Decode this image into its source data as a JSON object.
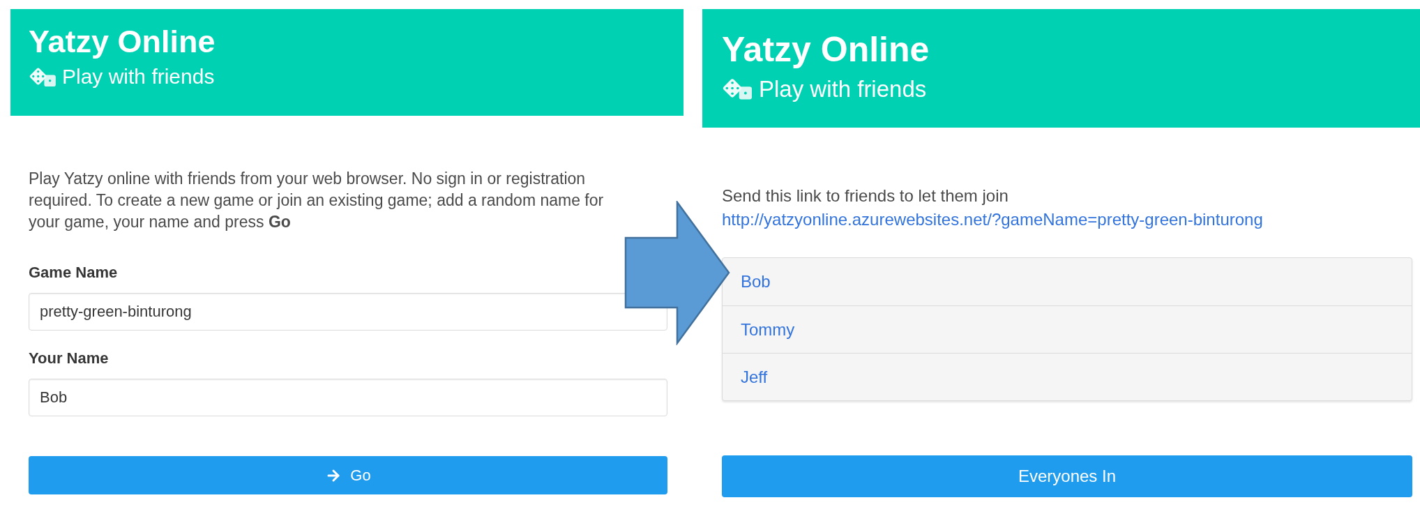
{
  "join_screen": {
    "header": {
      "title": "Yatzy Online",
      "subtitle": "Play with friends"
    },
    "intro": "Play Yatzy online with friends from your web browser. No sign in or registration required. To create a new game or join an existing game; add a random name for your game, your name and press **Go**",
    "fields": [
      {
        "label": "Game Name",
        "value": "pretty-green-binturong"
      },
      {
        "label": "Your Name",
        "value": "Bob"
      }
    ],
    "button": {
      "label": "Go"
    }
  },
  "lobby_screen": {
    "header": {
      "title": "Yatzy Online",
      "subtitle": "Play with friends"
    },
    "message": "Send this link to friends to let them join",
    "link": "http://yatzyonline.azurewebsites.net/?gameName=pretty-green-binturong",
    "players": [
      "Bob",
      "Tommy",
      "Jeff"
    ],
    "button": {
      "label": "Everyones In"
    }
  }
}
